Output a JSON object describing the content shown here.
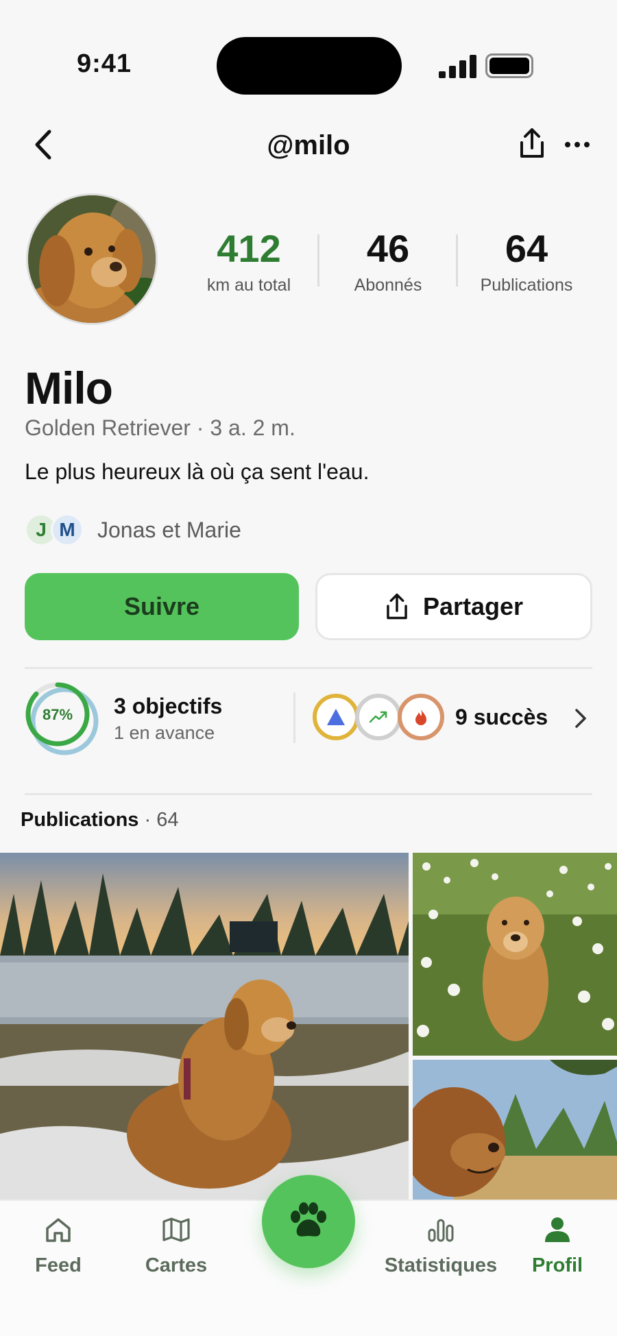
{
  "status_bar": {
    "time": "9:41"
  },
  "header": {
    "title": "@milo"
  },
  "stats": [
    {
      "value": "412",
      "label": "km au total",
      "color": "#2e7d32"
    },
    {
      "value": "46",
      "label": "Abonnés",
      "color": "#111111"
    },
    {
      "value": "64",
      "label": "Publications",
      "color": "#111111"
    }
  ],
  "profile": {
    "name": "Milo",
    "breed": "Golden Retriever · 3 a. 2 m.",
    "bio": "Le plus heureux là où ça sent l'eau.",
    "owners": {
      "initials": [
        "J",
        "M"
      ],
      "text": "Jonas et Marie"
    }
  },
  "actions": {
    "follow_label": "Suivre",
    "share_label": "Partager"
  },
  "goals": {
    "percent_label": "87%",
    "progress": 0.87,
    "title": "3 objectifs",
    "subtitle": "1 en avance"
  },
  "achievements": {
    "badges": [
      "mountain-badge-icon",
      "trend-up-badge-icon",
      "flame-badge-icon"
    ],
    "label": "9 succès"
  },
  "publications": {
    "title": "Publications",
    "count": "· 64"
  },
  "tabbar": {
    "items": [
      {
        "label": "Feed",
        "icon": "home-icon"
      },
      {
        "label": "Cartes",
        "icon": "map-icon"
      },
      {
        "label": "Statistiques",
        "icon": "bar-chart-icon"
      },
      {
        "label": "Profil",
        "icon": "person-icon"
      }
    ],
    "center_icon": "paw-icon",
    "active": "Profil"
  },
  "colors": {
    "accent": "#55c35c",
    "accent_dark": "#2e7d32"
  }
}
